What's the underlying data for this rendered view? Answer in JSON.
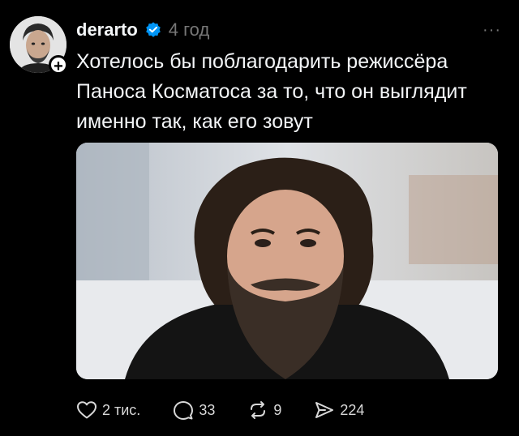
{
  "post": {
    "username": "derarto",
    "timestamp": "4 год",
    "more_label": "···",
    "text": "Хотелось бы поблагодарить режиссёра Паноса Косматоса за то, что он выглядит именно так, как его зовут",
    "follow_label": "+"
  },
  "actions": {
    "likes": "2 тис.",
    "comments": "33",
    "reposts": "9",
    "shares": "224"
  },
  "icons": {
    "verified": "verified-badge-icon",
    "like": "heart-icon",
    "comment": "comment-bubble-icon",
    "repost": "repost-icon",
    "share": "send-icon"
  },
  "colors": {
    "background": "#000000",
    "text": "#f3f5f7",
    "muted": "#777777",
    "verified": "#0095f6"
  }
}
